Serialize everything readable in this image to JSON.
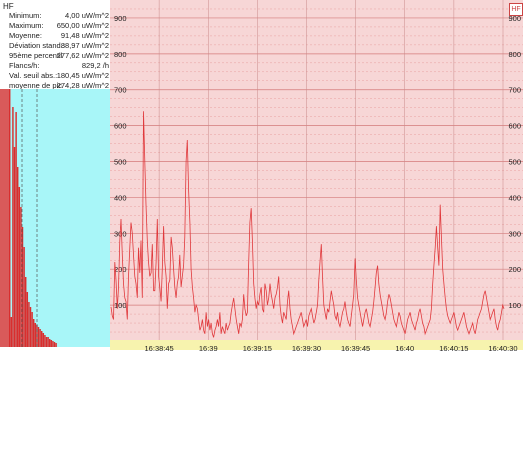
{
  "panel": {
    "title": "HF",
    "stats": [
      {
        "label": "Minimum:",
        "value": "4,00 uW/m^2"
      },
      {
        "label": "Maximum:",
        "value": "650,00 uW/m^2"
      },
      {
        "label": "Moyenne:",
        "value": "91,48 uW/m^2"
      },
      {
        "label": "Déviation stand.:",
        "value": "88,97 uW/m^2"
      },
      {
        "label": "95ème percentil",
        "value": "277,62 uW/m^2"
      },
      {
        "label": "Flancs/h:",
        "value": "829,2 /h"
      },
      {
        "label": "Val. seuil abs.:",
        "value": "180,45 uW/m^2"
      },
      {
        "label": "moyenne de pic",
        "value": "274,28 uW/m^2"
      }
    ]
  },
  "badge": "HF",
  "colors": {
    "plot_bg": "#f7d6d6",
    "line": "#e0393c",
    "hist_bg": "#a8f6f8",
    "hist_bar": "#d92e2e",
    "time_bar": "#f7f3ae"
  },
  "chart_data": {
    "type": "line",
    "title": "",
    "xlabel": "",
    "ylabel": "",
    "ylim": [
      0,
      950
    ],
    "y_ticks": [
      100,
      200,
      300,
      400,
      500,
      600,
      700,
      800,
      900
    ],
    "y_tick_labels": [
      "100",
      "200",
      "300",
      "400",
      "500",
      "600",
      "700",
      "800",
      "900"
    ],
    "x_tick_labels": [
      "16:38:45",
      "16:39",
      "16:39:15",
      "16:39:30",
      "16:39:45",
      "16:40",
      "16:40:15",
      "16:40:30"
    ],
    "x_range_seconds": [
      0,
      120
    ],
    "x_tick_seconds": [
      15,
      30,
      45,
      60,
      75,
      90,
      105,
      120
    ],
    "series": [
      {
        "values": [
          95,
          70,
          60,
          220,
          170,
          90,
          150,
          280,
          340,
          240,
          160,
          120,
          110,
          60,
          180,
          260,
          330,
          300,
          240,
          180,
          160,
          120,
          260,
          190,
          280,
          120,
          640,
          500,
          380,
          280,
          220,
          180,
          190,
          270,
          140,
          140,
          220,
          340,
          180,
          150,
          110,
          200,
          320,
          220,
          180,
          90,
          160,
          170,
          290,
          260,
          200,
          150,
          120,
          160,
          180,
          240,
          150,
          180,
          210,
          290,
          500,
          560,
          420,
          330,
          200,
          150,
          120,
          80,
          100,
          90,
          60,
          30,
          40,
          60,
          30,
          20,
          80,
          40,
          60,
          30,
          50,
          20,
          10,
          30,
          40,
          60,
          40,
          80,
          20,
          40,
          30,
          20,
          50,
          30,
          40,
          50,
          80,
          100,
          120,
          90,
          60,
          40,
          20,
          50,
          40,
          60,
          130,
          90,
          70,
          80,
          220,
          330,
          370,
          280,
          160,
          120,
          90,
          110,
          100,
          130,
          150,
          90,
          80,
          160,
          140,
          100,
          120,
          160,
          130,
          110,
          90,
          120,
          130,
          150,
          180,
          100,
          70,
          50,
          80,
          70,
          60,
          110,
          140,
          90,
          60,
          40,
          20,
          30,
          40,
          50,
          60,
          70,
          80,
          60,
          40,
          50,
          60,
          40,
          70,
          80,
          90,
          70,
          50,
          60,
          80,
          100,
          170,
          220,
          270,
          180,
          100,
          80,
          60,
          90,
          80,
          110,
          140,
          120,
          100,
          70,
          60,
          80,
          50,
          40,
          60,
          80,
          90,
          110,
          80,
          60,
          50,
          40,
          70,
          100,
          130,
          230,
          170,
          120,
          100,
          80,
          60,
          40,
          60,
          80,
          90,
          70,
          50,
          40,
          60,
          80,
          110,
          150,
          190,
          210,
          160,
          130,
          110,
          90,
          70,
          60,
          80,
          110,
          130,
          120,
          100,
          80,
          60,
          50,
          40,
          60,
          80,
          70,
          50,
          40,
          30,
          20,
          40,
          60,
          70,
          80,
          60,
          50,
          40,
          30,
          50,
          60,
          80,
          90,
          70,
          50,
          40,
          20,
          30,
          40,
          50,
          60,
          90,
          160,
          210,
          260,
          320,
          260,
          210,
          380,
          290,
          200,
          160,
          120,
          90,
          70,
          60,
          50,
          60,
          70,
          80,
          60,
          40,
          30,
          40,
          50,
          60,
          70,
          80,
          60,
          40,
          30,
          20,
          30,
          40,
          50,
          30,
          20,
          40,
          60,
          70,
          80,
          90,
          110,
          130,
          140,
          120,
          100,
          80,
          60,
          70,
          80,
          90,
          60,
          40,
          30,
          50,
          60,
          80,
          100,
          90
        ]
      }
    ],
    "histogram": {
      "type": "bar",
      "values": [
        258,
        30,
        240,
        200,
        235,
        180,
        160,
        140,
        120,
        100,
        70,
        55,
        45,
        40,
        35,
        28,
        24,
        22,
        20,
        18,
        16,
        14,
        12,
        10,
        10,
        8,
        7,
        6,
        5,
        4
      ]
    }
  }
}
